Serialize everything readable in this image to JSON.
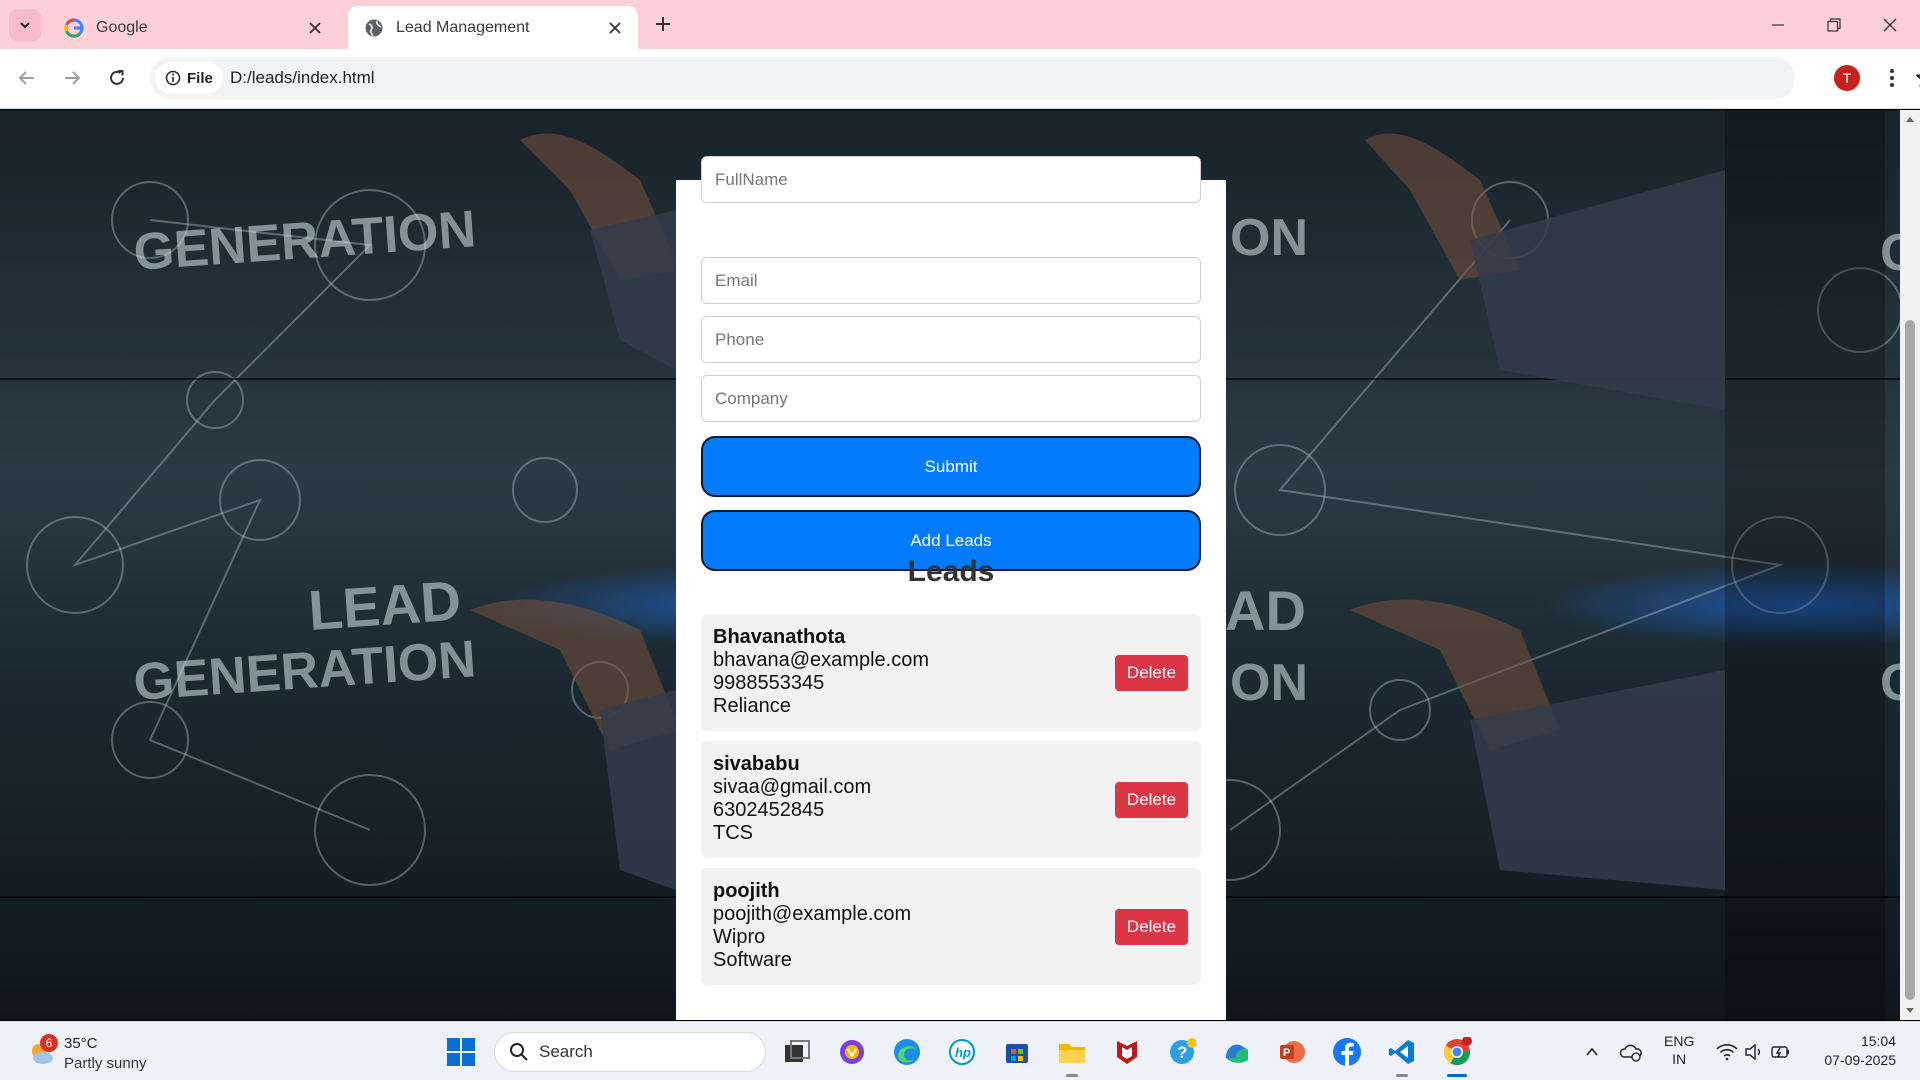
{
  "browser": {
    "tabs": [
      {
        "title": "Google",
        "icon": "google-icon",
        "active": false
      },
      {
        "title": "Lead Management",
        "icon": "globe-icon",
        "active": true
      }
    ],
    "url_chip": "File",
    "url": "D:/leads/index.html",
    "profile_initial": "T"
  },
  "form": {
    "fullname_placeholder": "FullName",
    "email_placeholder": "Email",
    "phone_placeholder": "Phone",
    "company_placeholder": "Company",
    "submit_label": "Submit",
    "add_leads_label": "Add Leads"
  },
  "leads": {
    "title": "Leads",
    "items": [
      {
        "name": "Bhavanathota",
        "email": "bhavana@example.com",
        "phone": "9988553345",
        "company": "Reliance",
        "delete_label": "Delete"
      },
      {
        "name": "sivababu",
        "email": "sivaa@gmail.com",
        "phone": "6302452845",
        "company": "TCS",
        "delete_label": "Delete"
      },
      {
        "name": "poojith",
        "email": "poojith@example.com",
        "phone": "Wipro",
        "company": "Software",
        "delete_label": "Delete"
      }
    ]
  },
  "taskbar": {
    "weather_badge": "6",
    "temperature": "35°C",
    "condition": "Partly sunny",
    "search_label": "Search",
    "language_line1": "ENG",
    "language_line2": "IN",
    "time": "15:04",
    "date": "07-09-2025"
  },
  "colors": {
    "tabbar": "#fdd0d8",
    "primary_button": "#027bff",
    "delete_button": "#dc3545"
  }
}
